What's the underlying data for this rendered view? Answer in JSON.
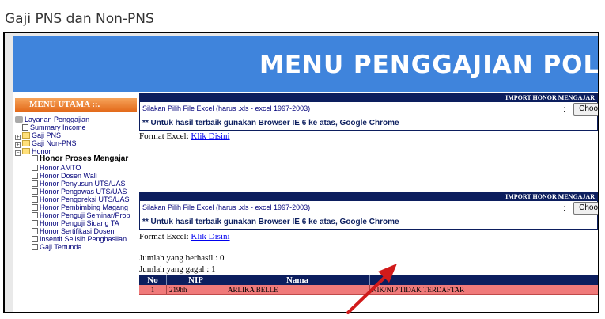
{
  "page": {
    "title": "Gaji PNS dan Non-PNS"
  },
  "banner": {
    "title": "MENU PENGGAJIAN POLITEKN"
  },
  "sidebar": {
    "header": "MENU UTAMA ::.",
    "items": [
      {
        "label": "Layanan Penggajian"
      },
      {
        "label": "Summary Income"
      },
      {
        "label": "Gaji PNS"
      },
      {
        "label": "Gaji Non-PNS"
      },
      {
        "label": "Honor"
      },
      {
        "label": "Honor Proses Mengajar"
      },
      {
        "label": "Honor AMTO"
      },
      {
        "label": "Honor Dosen Wali"
      },
      {
        "label": "Honor Penyusun UTS/UAS"
      },
      {
        "label": "Honor Pengawas UTS/UAS"
      },
      {
        "label": "Honor Pengoreksi UTS/UAS"
      },
      {
        "label": "Honor Pembimbing Magang"
      },
      {
        "label": "Honor Penguji Seminar/Prop"
      },
      {
        "label": "Honor Penguji Sidang TA"
      },
      {
        "label": "Honor Sertifikasi Dosen"
      },
      {
        "label": "Insentif Selisih Penghasilan"
      },
      {
        "label": "Gaji Tertunda"
      }
    ]
  },
  "panels": [
    {
      "header": "IMPORT HONOR MENGAJAR",
      "file_prompt": "Silakan Pilih File Excel (harus .xls - excel 1997-2003)",
      "choose_button": "Choo",
      "colon": ":",
      "browser_note": "** Untuk hasil terbaik gunakan Browser IE 6 ke atas, Google Chrome",
      "format_label": "Format Excel:",
      "format_link": "Klik Disini"
    },
    {
      "header": "IMPORT HONOR MENGAJAR",
      "file_prompt": "Silakan Pilih File Excel (harus .xls - excel 1997-2003)",
      "choose_button": "Choo",
      "colon": ":",
      "browser_note": "** Untuk hasil terbaik gunakan Browser IE 6 ke atas, Google Chrome",
      "format_label": "Format Excel:",
      "format_link": "Klik Disini"
    }
  ],
  "import_result": {
    "success": "Jumlah yang berhasil : 0",
    "failed": "Jumlah yang gagal : 1"
  },
  "table": {
    "headers": [
      "No",
      "NIP",
      "Nama",
      ""
    ],
    "rows": [
      [
        "1",
        "219hh",
        "ARLIKA BELLE",
        "NIK/NIP TIDAK TERDAFTAR"
      ]
    ]
  },
  "colors": {
    "banner": "#3f84dc",
    "navy": "#0c1e5e",
    "error_row": "#f07a7a",
    "menu_header": "#e36a1a",
    "arrow": "#d11a1a"
  }
}
